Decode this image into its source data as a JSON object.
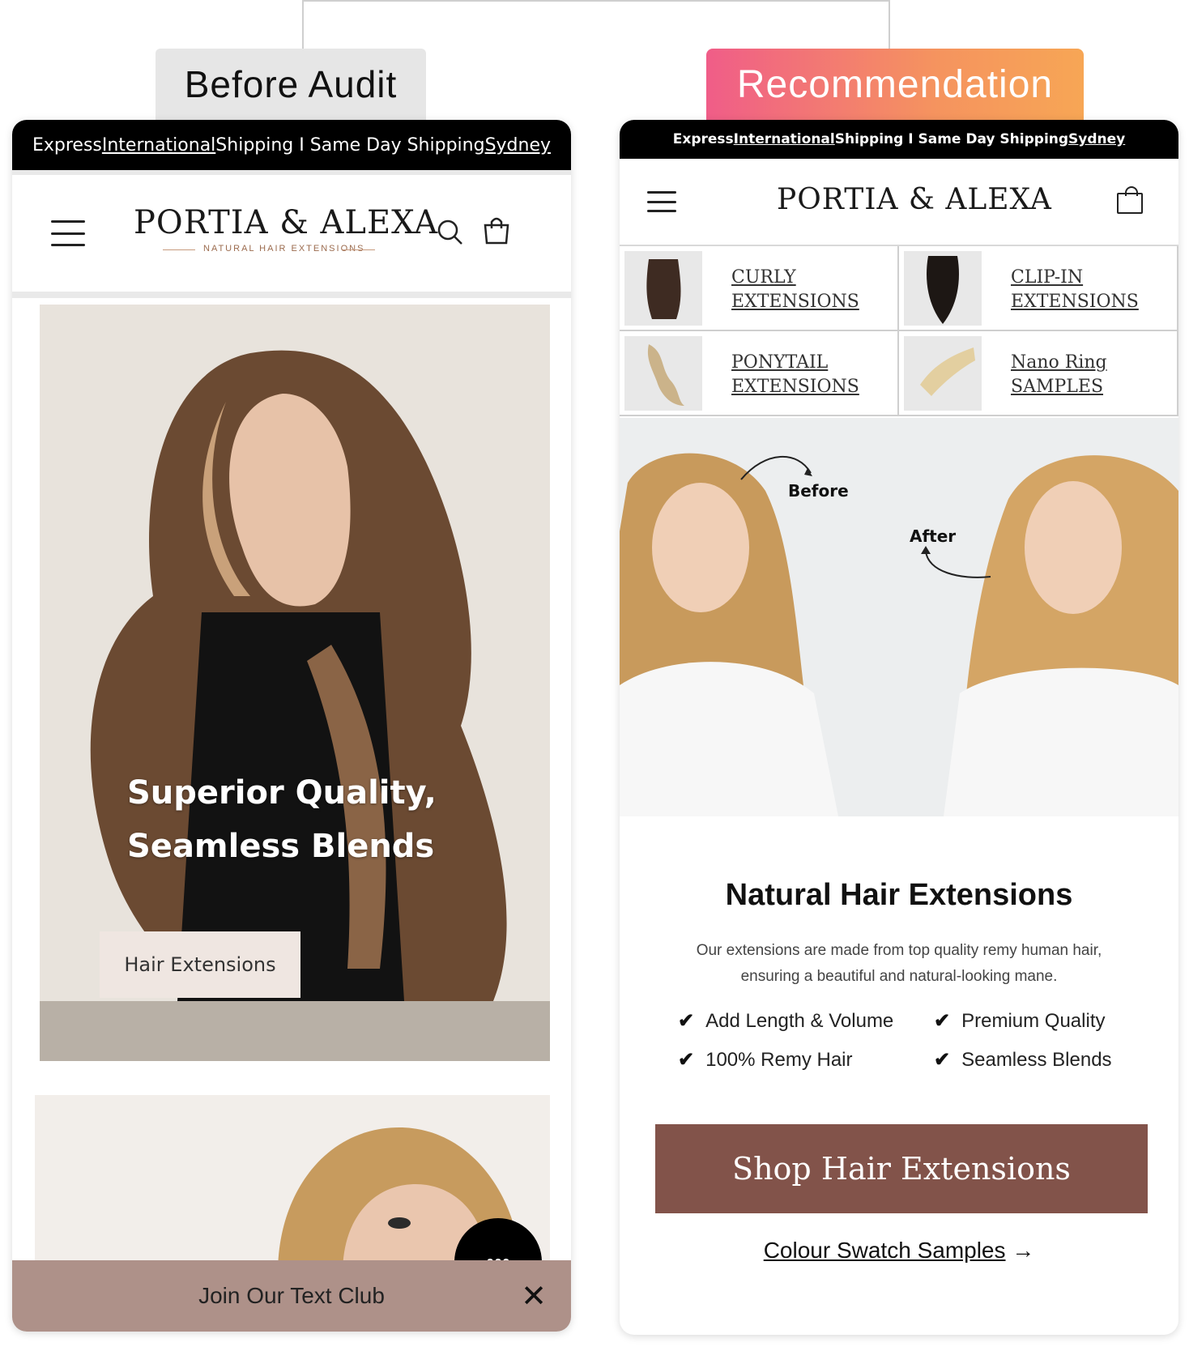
{
  "labels": {
    "before": "Before Audit",
    "recommendation": "Recommendation"
  },
  "before": {
    "topbar": {
      "part1": "Express ",
      "international": "International",
      "part2": " Shipping I Same Day Shipping ",
      "sydney": "Sydney"
    },
    "brand": "PORTIA & ALEXA",
    "tagline": "NATURAL HAIR EXTENSIONS",
    "hero": {
      "line1": "Superior Quality,",
      "line2": "Seamless Blends",
      "button": "Hair Extensions"
    },
    "text_club": "Join Our Text Club",
    "chat_glyph": "•••",
    "close_glyph": "✕"
  },
  "after": {
    "topbar": {
      "part1": "Express ",
      "international": "International",
      "part2": " Shipping I Same Day Shipping ",
      "sydney": "Sydney"
    },
    "brand": "PORTIA & ALEXA",
    "categories": [
      {
        "line1": "CURLY",
        "line2": "EXTENSIONS"
      },
      {
        "line1": "CLIP-IN",
        "line2": "EXTENSIONS"
      },
      {
        "line1": "PONYTAIL",
        "line2": "EXTENSIONS"
      },
      {
        "line1": "Nano Ring",
        "line2": "SAMPLES"
      }
    ],
    "before_label": "Before",
    "after_label": "After",
    "title": "Natural Hair Extensions",
    "description": "Our extensions are made from top quality remy human hair, ensuring a beautiful and natural-looking mane.",
    "features": [
      "Add Length & Volume",
      "Premium Quality",
      "100% Remy Hair",
      "Seamless Blends"
    ],
    "check_glyph": "✔",
    "cta": "Shop Hair Extensions",
    "swatch_link": "Colour Swatch Samples",
    "arrow_glyph": "→"
  },
  "colors": {
    "cta": "#82534a",
    "text_club_bar": "#ae9189",
    "gradient_start": "#f05d88",
    "gradient_end": "#f7a655"
  }
}
